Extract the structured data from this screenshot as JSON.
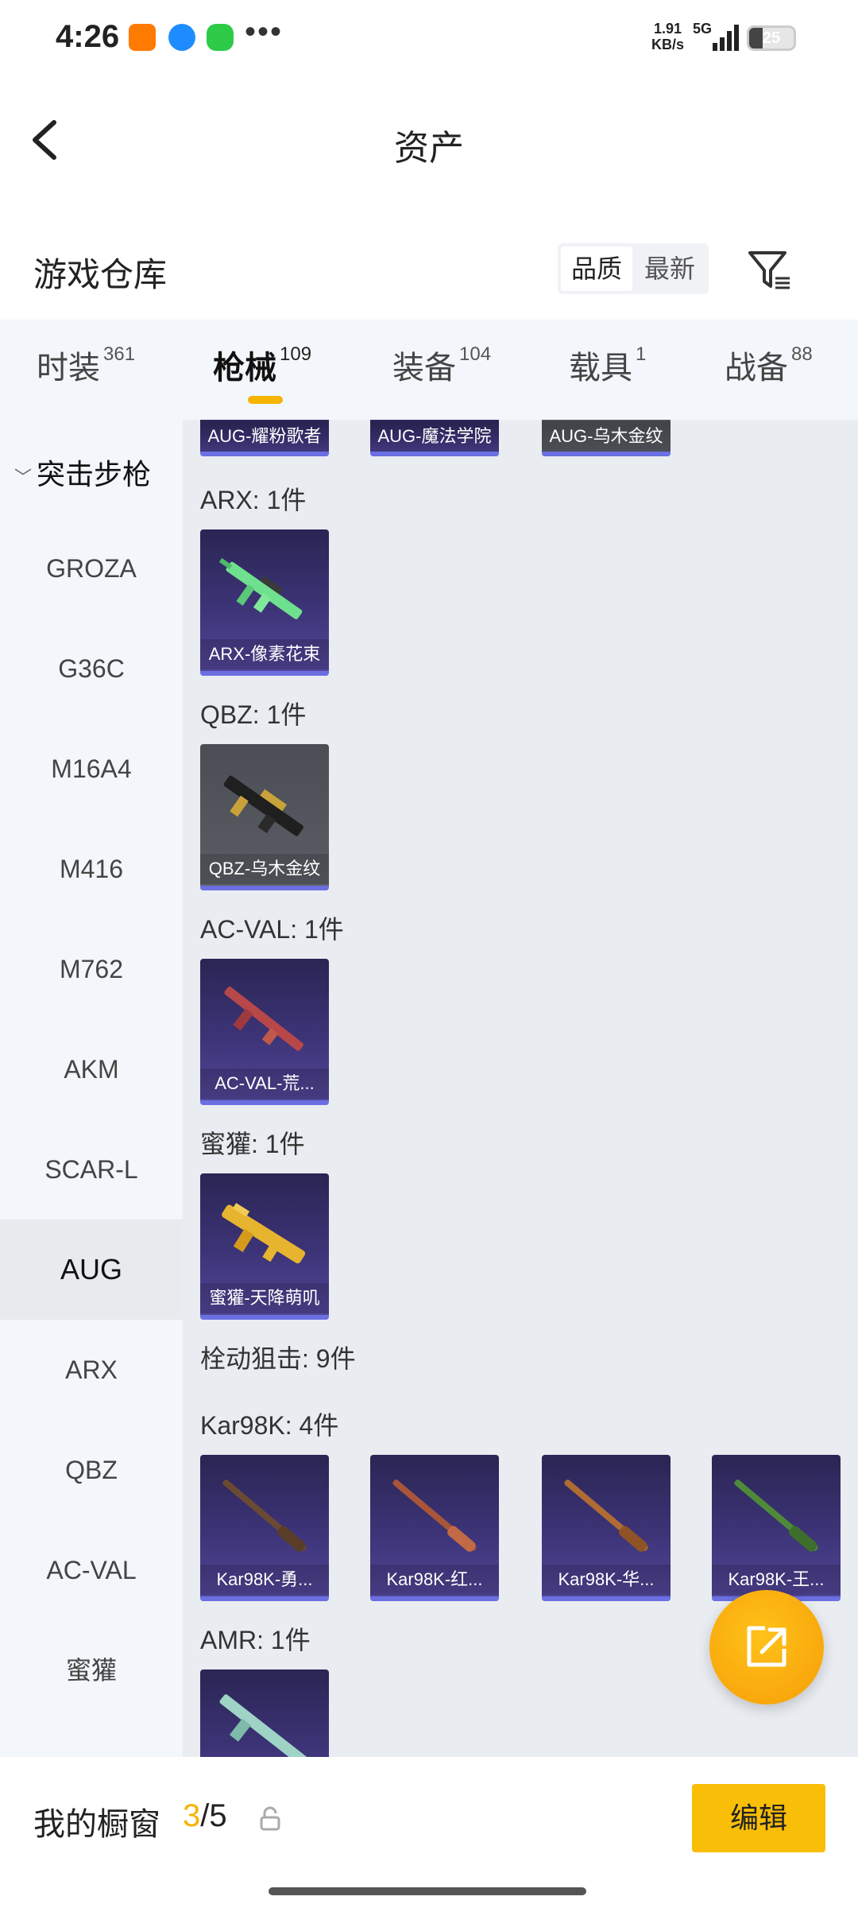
{
  "status_bar": {
    "time": "4:26",
    "net_speed_value": "1.91",
    "net_speed_unit": "KB/s",
    "network": "5G",
    "battery": "25"
  },
  "nav": {
    "title": "资产",
    "back_icon": "chevron-left-icon"
  },
  "section": {
    "title": "游戏仓库",
    "sort_quality": "品质",
    "sort_newest": "最新",
    "filter_icon": "filter-icon"
  },
  "tabs": [
    {
      "label": "时装",
      "count": "361"
    },
    {
      "label": "枪械",
      "count": "109"
    },
    {
      "label": "装备",
      "count": "104"
    },
    {
      "label": "载具",
      "count": "1"
    },
    {
      "label": "战备",
      "count": "88"
    }
  ],
  "sidebar": {
    "group": "突击步枪",
    "items": [
      "GROZA",
      "G36C",
      "M16A4",
      "M416",
      "M762",
      "AKM",
      "SCAR-L",
      "AUG",
      "ARX",
      "QBZ",
      "AC-VAL",
      "蜜獾"
    ],
    "active": "AUG"
  },
  "content": {
    "top_cards": [
      "AUG-耀粉歌者",
      "AUG-魔法学院",
      "AUG-乌木金纹"
    ],
    "groups": [
      {
        "label": "ARX: 1件",
        "cards": [
          "ARX-像素花束"
        ]
      },
      {
        "label": "QBZ: 1件",
        "cards": [
          "QBZ-乌木金纹"
        ]
      },
      {
        "label": "AC-VAL: 1件",
        "cards": [
          "AC-VAL-荒..."
        ]
      },
      {
        "label": "蜜獾: 1件",
        "cards": [
          "蜜獾-天降萌叽"
        ]
      }
    ],
    "category_label": "栓动狙击: 9件",
    "kar_label": "Kar98K: 4件",
    "kar_cards": [
      "Kar98K-勇...",
      "Kar98K-红...",
      "Kar98K-华...",
      "Kar98K-王..."
    ],
    "amr_label": "AMR: 1件"
  },
  "bottom": {
    "showcase_label": "我的橱窗",
    "showcase_current": "3",
    "showcase_total": "/5",
    "edit_label": "编辑"
  }
}
